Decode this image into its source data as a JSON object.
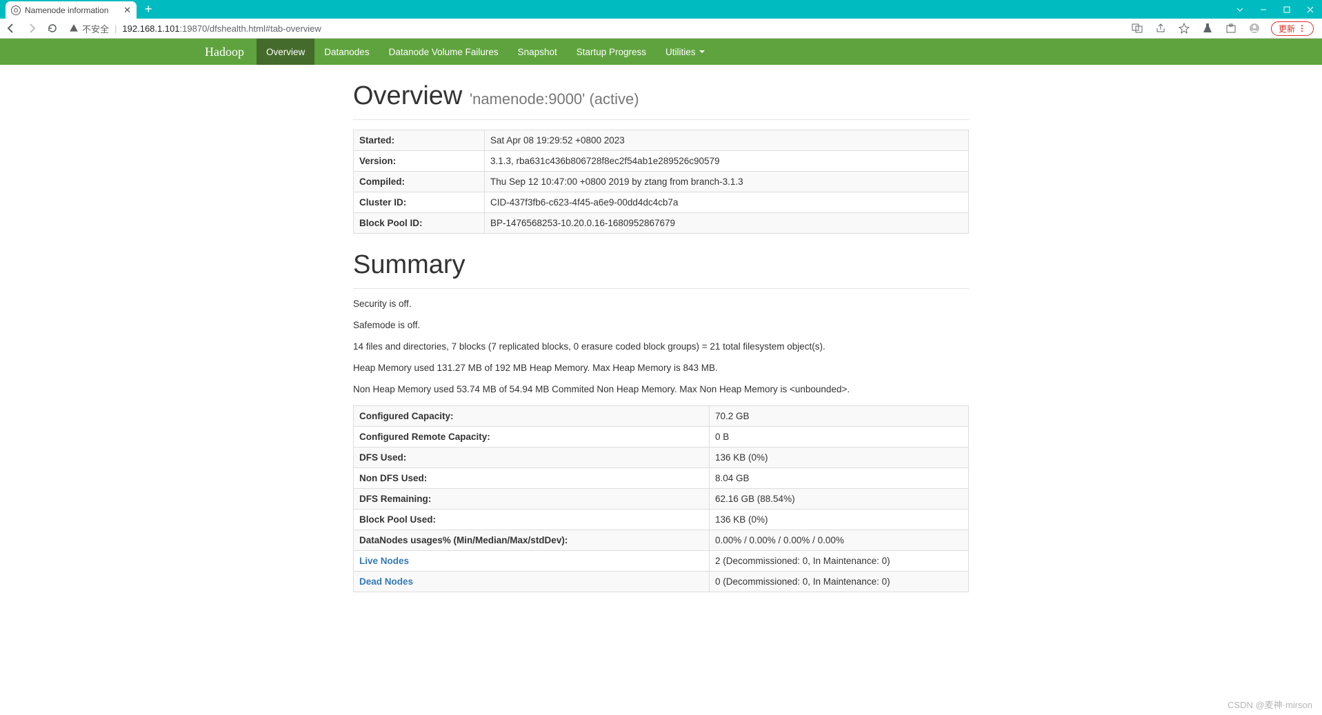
{
  "browser": {
    "tab_title": "Namenode information",
    "security_label": "不安全",
    "url_host": "192.168.1.101",
    "url_port_path": ":19870/dfshealth.html#tab-overview",
    "update_label": "更新"
  },
  "nav": {
    "brand": "Hadoop",
    "items": [
      {
        "label": "Overview",
        "active": true
      },
      {
        "label": "Datanodes"
      },
      {
        "label": "Datanode Volume Failures"
      },
      {
        "label": "Snapshot"
      },
      {
        "label": "Startup Progress"
      },
      {
        "label": "Utilities",
        "dropdown": true
      }
    ]
  },
  "overview": {
    "heading": "Overview",
    "subheading": "'namenode:9000' (active)",
    "rows": [
      {
        "label": "Started:",
        "value": "Sat Apr 08 19:29:52 +0800 2023"
      },
      {
        "label": "Version:",
        "value": "3.1.3, rba631c436b806728f8ec2f54ab1e289526c90579"
      },
      {
        "label": "Compiled:",
        "value": "Thu Sep 12 10:47:00 +0800 2019 by ztang from branch-3.1.3"
      },
      {
        "label": "Cluster ID:",
        "value": "CID-437f3fb6-c623-4f45-a6e9-00dd4dc4cb7a"
      },
      {
        "label": "Block Pool ID:",
        "value": "BP-1476568253-10.20.0.16-1680952867679"
      }
    ]
  },
  "summary": {
    "heading": "Summary",
    "lines": [
      "Security is off.",
      "Safemode is off.",
      "14 files and directories, 7 blocks (7 replicated blocks, 0 erasure coded block groups) = 21 total filesystem object(s).",
      "Heap Memory used 131.27 MB of 192 MB Heap Memory. Max Heap Memory is 843 MB.",
      "Non Heap Memory used 53.74 MB of 54.94 MB Commited Non Heap Memory. Max Non Heap Memory is <unbounded>."
    ],
    "rows": [
      {
        "label": "Configured Capacity:",
        "value": "70.2 GB"
      },
      {
        "label": "Configured Remote Capacity:",
        "value": "0 B"
      },
      {
        "label": "DFS Used:",
        "value": "136 KB (0%)"
      },
      {
        "label": "Non DFS Used:",
        "value": "8.04 GB"
      },
      {
        "label": "DFS Remaining:",
        "value": "62.16 GB (88.54%)"
      },
      {
        "label": "Block Pool Used:",
        "value": "136 KB (0%)"
      },
      {
        "label": "DataNodes usages% (Min/Median/Max/stdDev):",
        "value": "0.00% / 0.00% / 0.00% / 0.00%"
      },
      {
        "label": "Live Nodes",
        "value": "2 (Decommissioned: 0, In Maintenance: 0)",
        "link": true
      },
      {
        "label": "Dead Nodes",
        "value": "0 (Decommissioned: 0, In Maintenance: 0)",
        "link": true
      }
    ]
  },
  "watermark": "CSDN @麦神·mirson"
}
